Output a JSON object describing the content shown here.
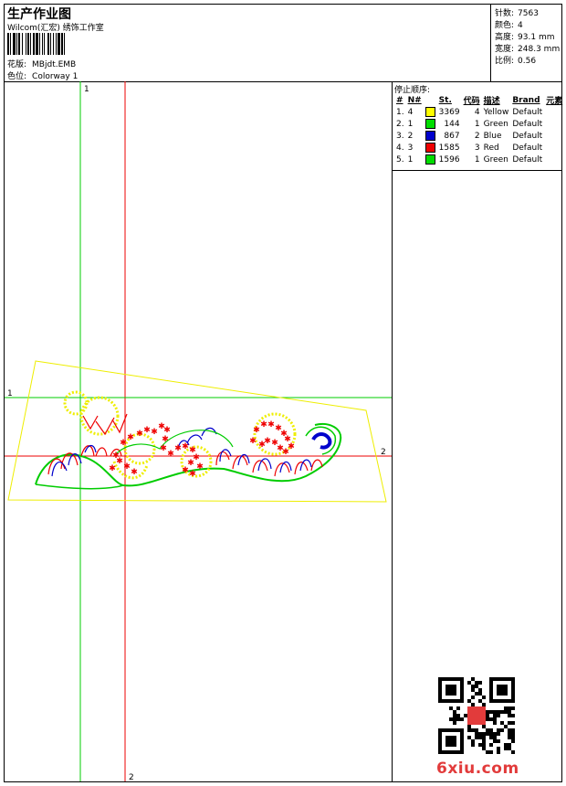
{
  "header": {
    "title": "生产作业图",
    "subtitle": "Wilcom(汇宏) 绣饰工作室",
    "pattern_label": "花版:",
    "pattern_value": "MBjdt.EMB",
    "colorway_label": "色位:",
    "colorway_value": "Colorway 1"
  },
  "info": {
    "stitches_label": "针数:",
    "stitches_value": "7563",
    "colors_label": "颜色:",
    "colors_value": "4",
    "height_label": "高度:",
    "height_value": "93.1 mm",
    "width_label": "宽度:",
    "width_value": "248.3 mm",
    "scale_label": "比例:",
    "scale_value": "0.56"
  },
  "stop_sequence": {
    "title": "停止顺序:",
    "headers": [
      "#",
      "N#",
      "St.",
      "代码",
      "描述",
      "Brand",
      "元素"
    ],
    "rows": [
      {
        "idx": "1.",
        "n": "4",
        "color": "#ffff00",
        "st": "3369",
        "code": "4",
        "desc": "Yellow",
        "brand": "Default"
      },
      {
        "idx": "2.",
        "n": "1",
        "color": "#00dd00",
        "st": "144",
        "code": "1",
        "desc": "Green",
        "brand": "Default"
      },
      {
        "idx": "3.",
        "n": "2",
        "color": "#0000cc",
        "st": "867",
        "code": "2",
        "desc": "Blue",
        "brand": "Default"
      },
      {
        "idx": "4.",
        "n": "3",
        "color": "#ee0000",
        "st": "1585",
        "code": "3",
        "desc": "Red",
        "brand": "Default"
      },
      {
        "idx": "5.",
        "n": "1",
        "color": "#00dd00",
        "st": "1596",
        "code": "1",
        "desc": "Green",
        "brand": "Default"
      }
    ]
  },
  "canvas": {
    "guide_labels": {
      "v1": "1",
      "v2": "2",
      "h1": "1",
      "h2": "2"
    },
    "colors": {
      "guide_green": "#00cc00",
      "guide_red": "#ee0000",
      "yellow": "#eeee00",
      "blue": "#0000cc"
    }
  },
  "watermark": "6xiu.com"
}
